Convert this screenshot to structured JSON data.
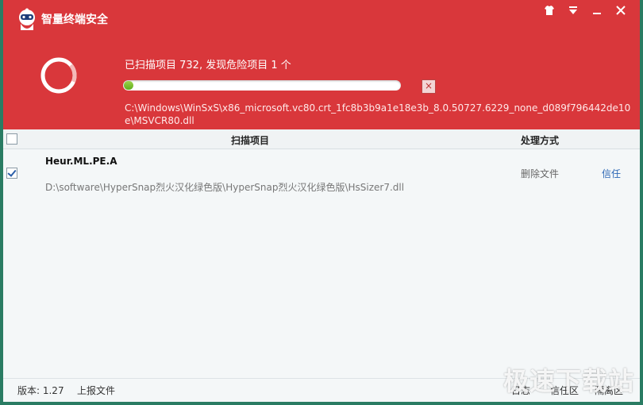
{
  "app": {
    "title": "智量终端安全"
  },
  "window_controls": {
    "skin_icon": "shirt-icon",
    "menu_icon": "menu-triangle-icon",
    "minimize_icon": "minimize-icon",
    "close_icon": "close-icon"
  },
  "scan": {
    "status": "已扫描项目 732, 发现危险项目 1 个",
    "progress": 0.03,
    "current_path": "C:\\Windows\\WinSxS\\x86_microsoft.vc80.crt_1fc8b3b9a1e18e3b_8.0.50727.6229_none_d089f796442de10e\\MSVCR80.dll",
    "stop_label": "×"
  },
  "table": {
    "headers": {
      "scan_item": "扫描项目",
      "action": "处理方式"
    },
    "rows": [
      {
        "checked": true,
        "name": "Heur.ML.PE.A",
        "path": "D:\\software\\HyperSnap烈火汉化绿色版\\HyperSnap烈火汉化绿色版\\HsSizer7.dll",
        "action": "删除文件",
        "trust": "信任"
      }
    ]
  },
  "footer": {
    "version": "版本: 1.27",
    "report": "上报文件",
    "link1": "日志",
    "link2": "信任区",
    "link3": "隔离区"
  },
  "watermark": "极速下载站",
  "colors": {
    "header_red": "#d9373b",
    "progress_green": "#6dbb24",
    "link_blue": "#2c67b5"
  }
}
